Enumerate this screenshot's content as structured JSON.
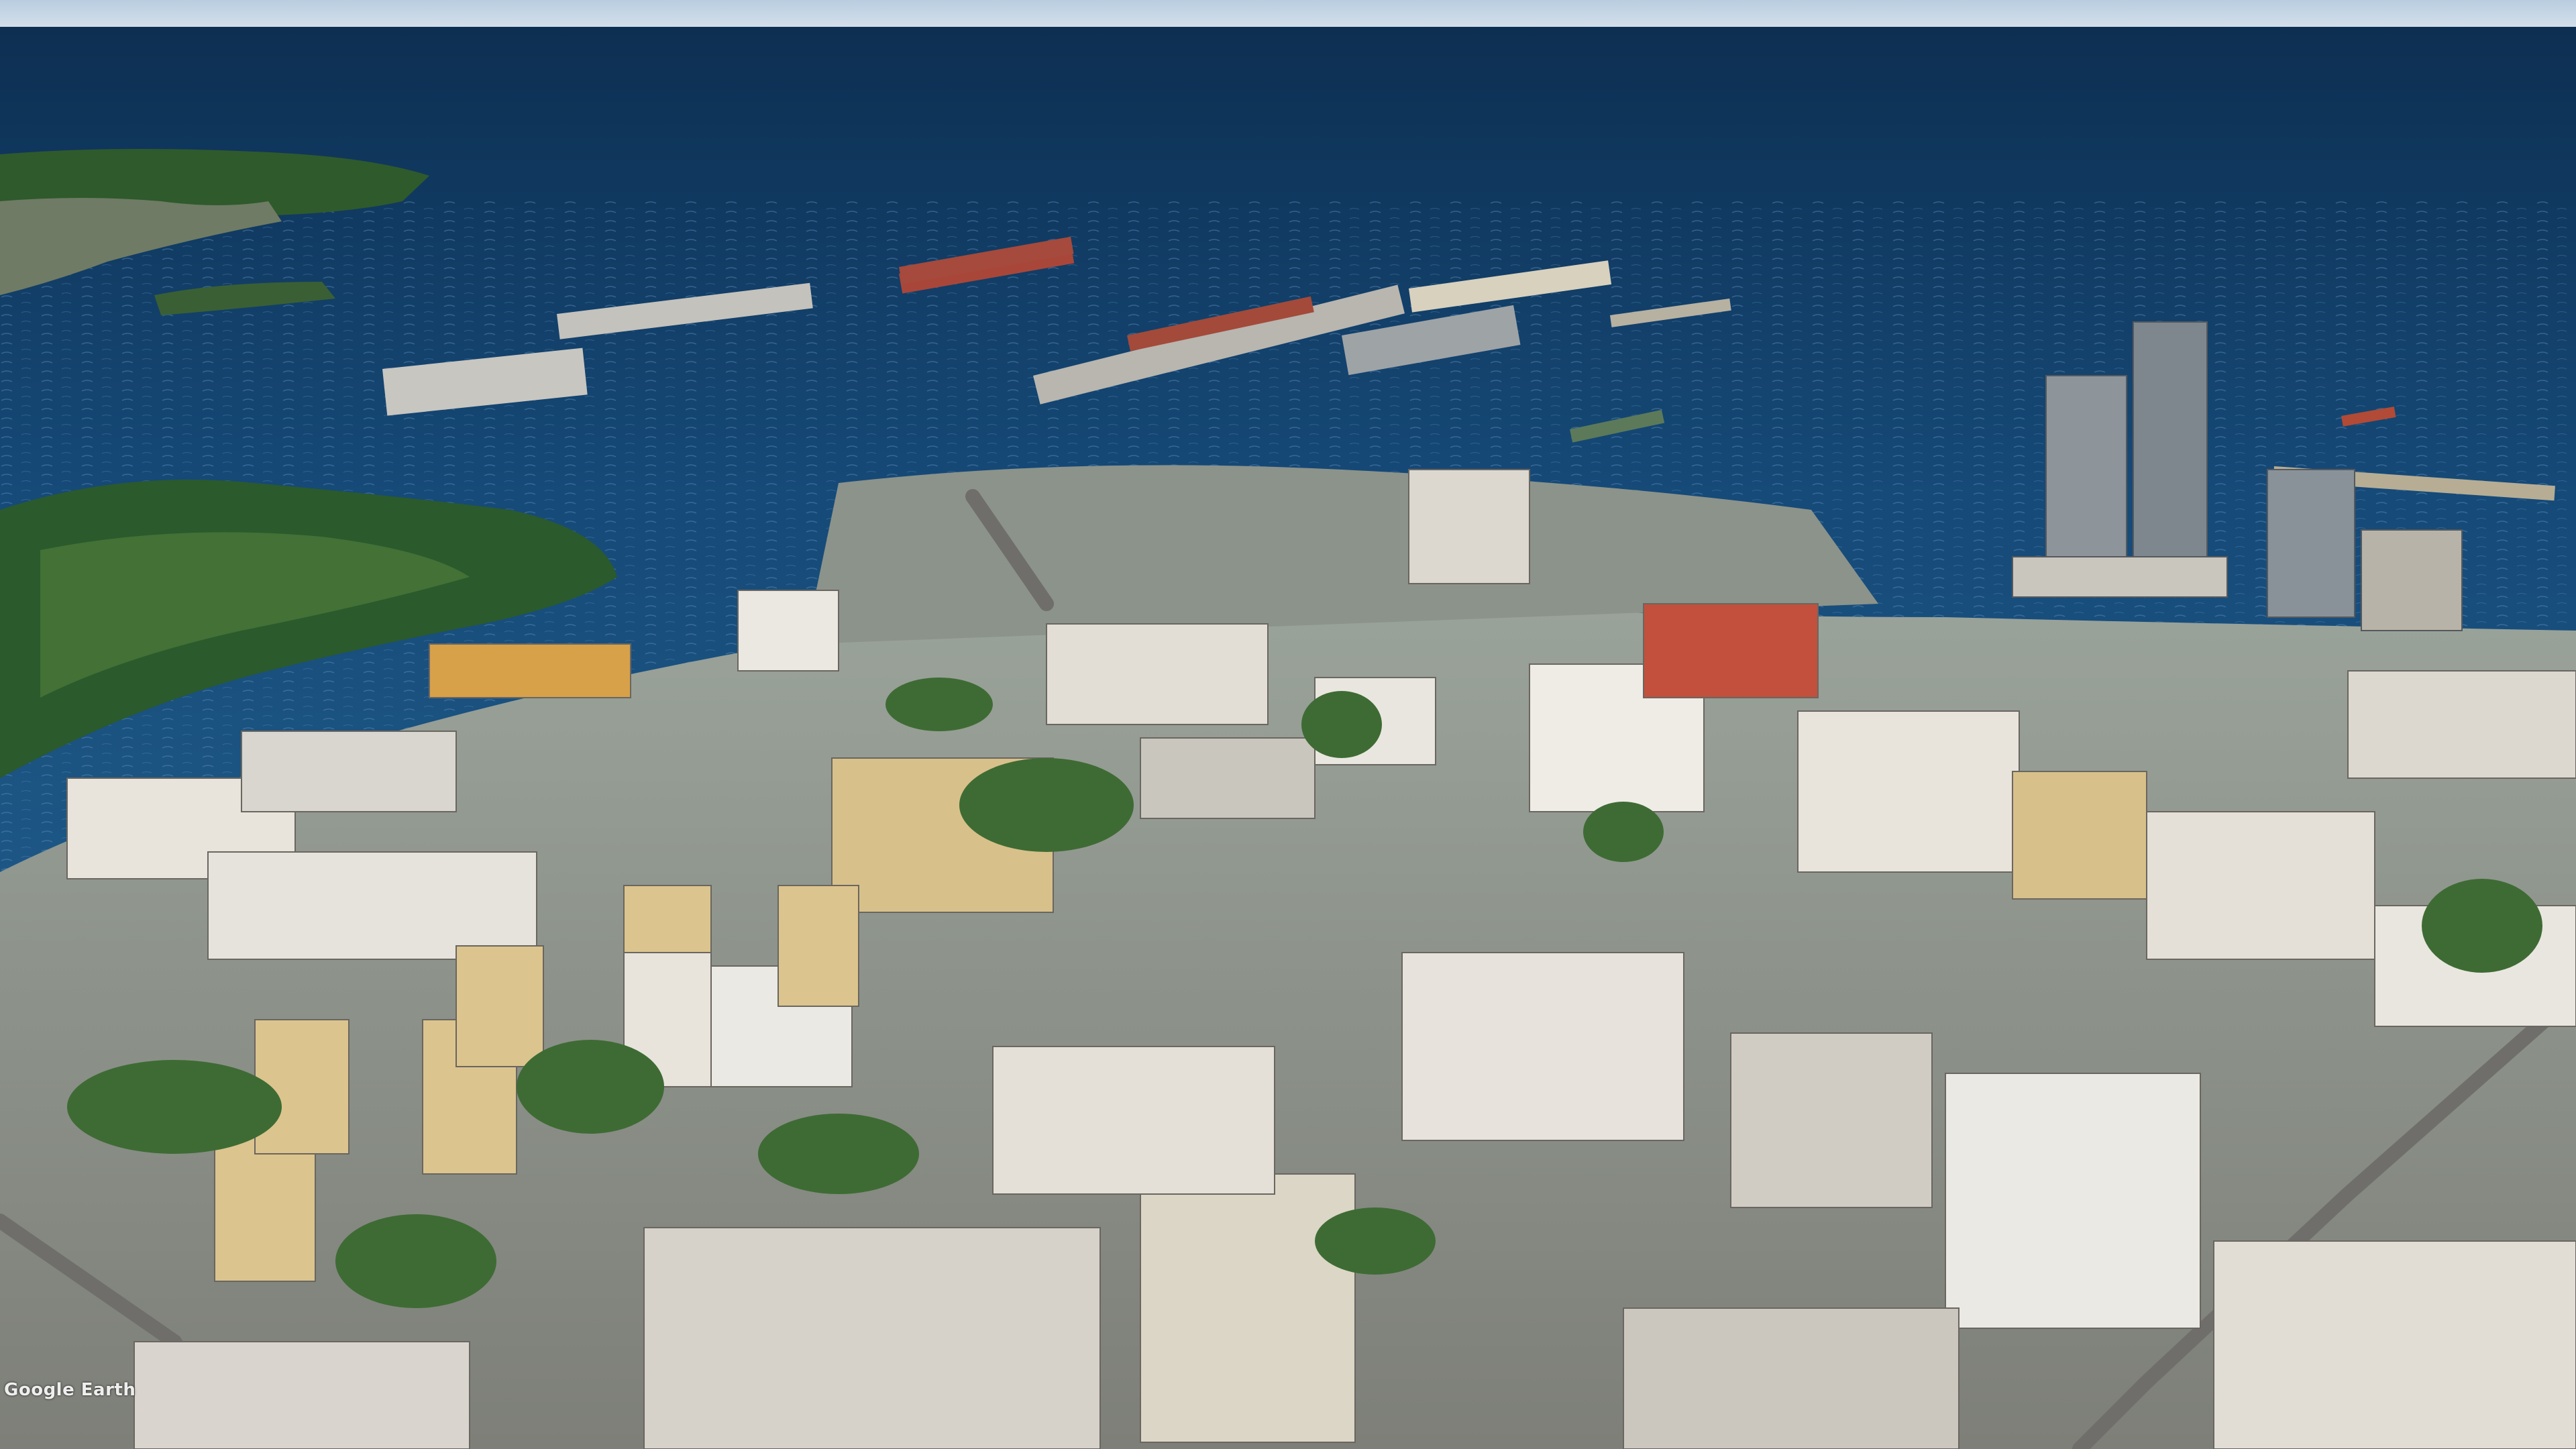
{
  "view": {
    "kind": "aerial-3d-photogrammetry",
    "colors": {
      "sky_top": "#b9cde0",
      "sky_horizon": "#d6e2ec",
      "sea_deep": "#0d2f52",
      "sea_mid": "#164a78",
      "sea_near": "#1f5a88",
      "wave_light": "#5f8fbd",
      "forest_dark": "#1f4a26",
      "forest_light": "#4e7a3a",
      "building_light": "#e8e4dc",
      "building_mid": "#cfc8bb",
      "building_warm": "#d8c08a",
      "roof_gray": "#8e8e8e",
      "roof_red": "#c2503c",
      "road": "#6f6e6b",
      "tower_glass": "#8d949a"
    }
  },
  "attribution": {
    "brand": "Google Earth",
    "line1": "",
    "line2": ""
  }
}
